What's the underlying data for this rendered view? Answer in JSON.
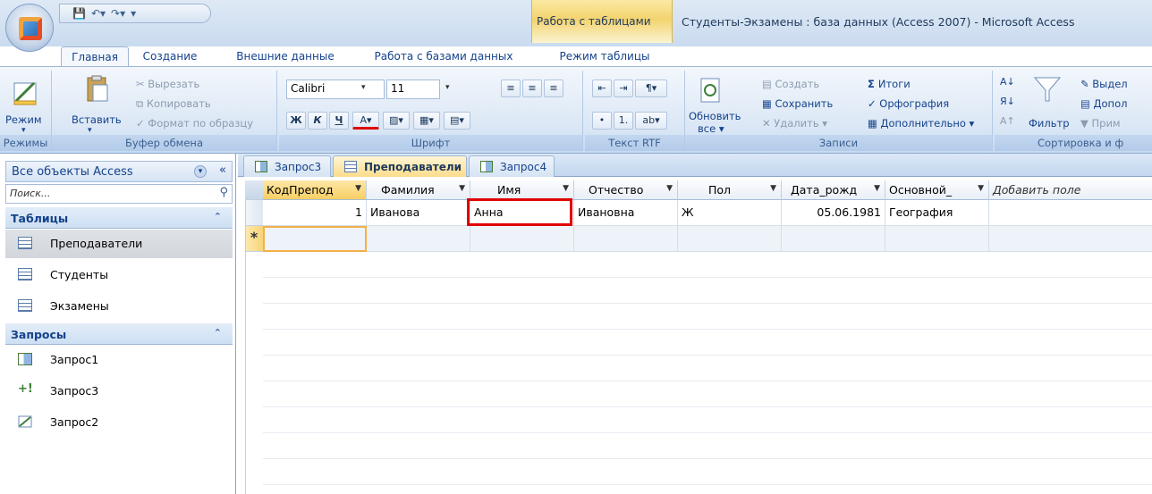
{
  "window": {
    "title": "Студенты-Экзамены : база данных (Access 2007) - Microsoft Access",
    "context_tab_title": "Работа с таблицами"
  },
  "ribbon_tabs": [
    "Главная",
    "Создание",
    "Внешние данные",
    "Работа с базами данных",
    "Режим таблицы"
  ],
  "ribbon": {
    "groups": {
      "views": "Режимы",
      "clipboard": "Буфер обмена",
      "font": "Шрифт",
      "rtf": "Текст RTF",
      "records": "Записи",
      "sort_filter": "Сортировка и ф"
    },
    "buttons": {
      "view": "Режим",
      "paste": "Вставить",
      "cut": "Вырезать",
      "copy": "Копировать",
      "format_painter": "Формат по образцу",
      "font_name": "Calibri",
      "font_size": "11",
      "refresh": "Обновить",
      "refresh_all": "все",
      "new": "Создать",
      "save": "Сохранить",
      "delete": "Удалить",
      "totals": "Итоги",
      "spelling": "Орфография",
      "more": "Дополнительно",
      "filter": "Фильтр",
      "selection": "Выдел",
      "advanced": "Допол",
      "apply": "Прим"
    }
  },
  "nav": {
    "header": "Все объекты Access",
    "search_placeholder": "Поиск...",
    "sections": [
      {
        "title": "Таблицы",
        "items": [
          "Преподаватели",
          "Студенты",
          "Экзамены"
        ]
      },
      {
        "title": "Запросы",
        "items": [
          "Запрос1",
          "Запрос3",
          "Запрос2"
        ]
      }
    ]
  },
  "doc_tabs": [
    "Запрос3",
    "Преподаватели",
    "Запрос4"
  ],
  "datasheet": {
    "columns": [
      "КодПрепод",
      "Фамилия",
      "Имя",
      "Отчество",
      "Пол",
      "Дата_рожд",
      "Основной_",
      "Добавить поле"
    ],
    "rows": [
      [
        "1",
        "Иванова",
        "Анна",
        "Ивановна",
        "Ж",
        "05.06.1981",
        "География",
        ""
      ]
    ],
    "new_row_marker": "*"
  },
  "colors": {
    "ribbon_blue": "#dbe7f5",
    "highlight_red": "#e00000",
    "selection_orange": "#f3b04a"
  }
}
